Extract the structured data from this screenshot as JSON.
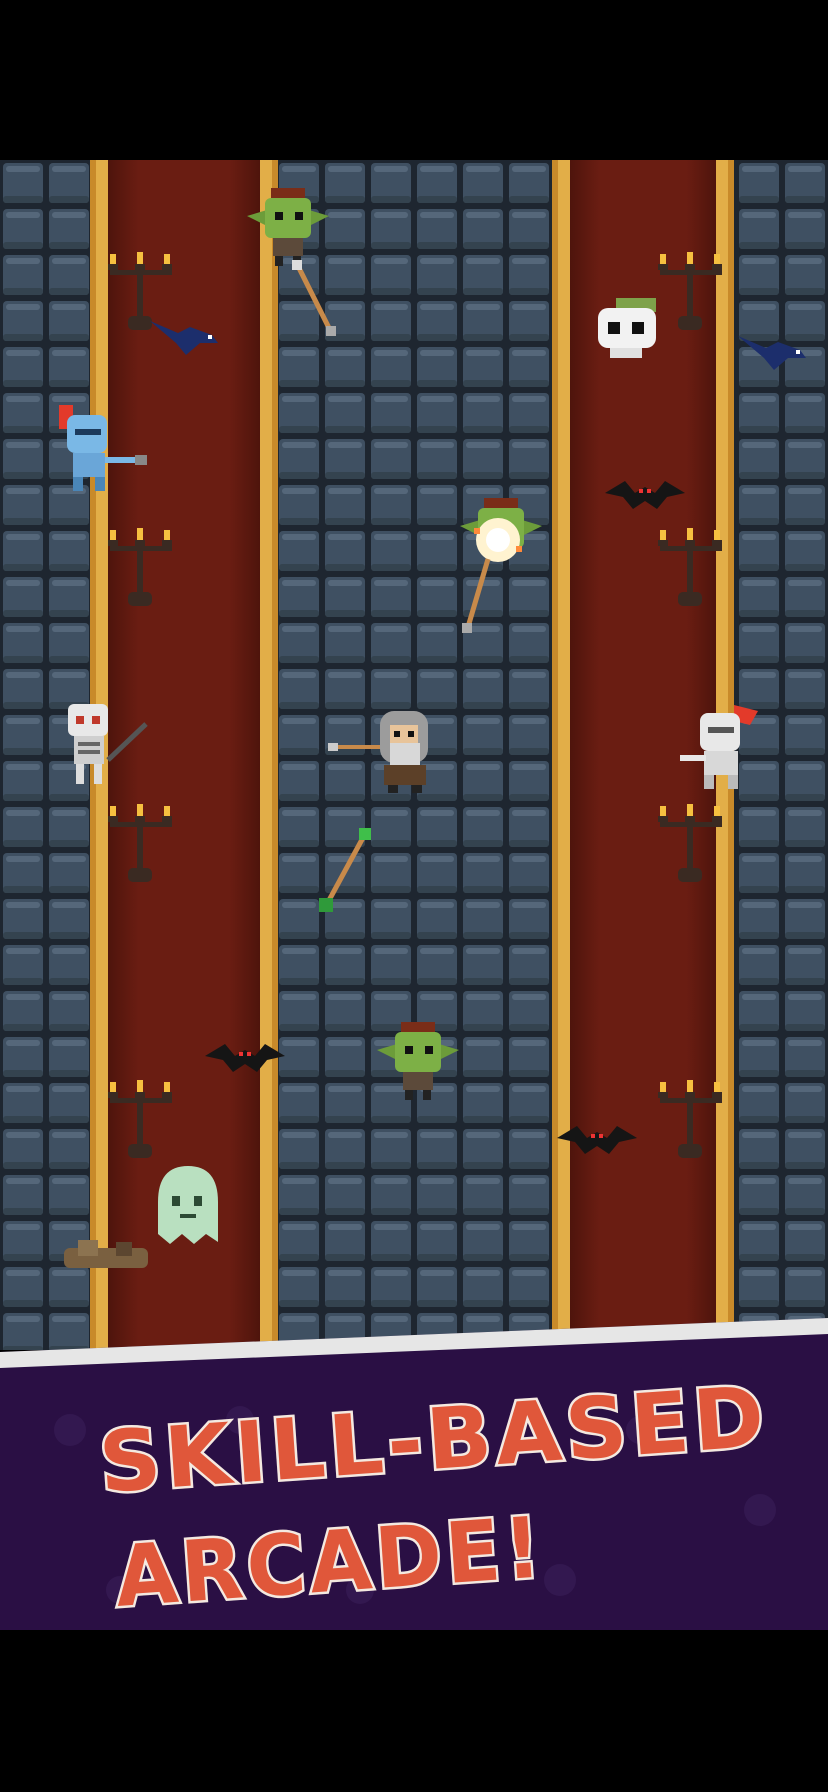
{
  "screen": {
    "caption_line_1": "SKILL-BASED",
    "caption_line_2": "ARCADE!"
  },
  "colors": {
    "background": "#000000",
    "stone": "#3f5062",
    "stone_highlight": "#6a7c8c",
    "stone_mortar": "#1e2630",
    "carpet": "#6a1d12",
    "carpet_gold_trim": "#d9a23a",
    "banner_purple": "#2a0f44",
    "banner_stripe": "#e6e6e6",
    "caption_fill": "#e0573a",
    "caption_outline": "#f4e9e0"
  },
  "sprites": {
    "goblin_top": "goblin-icon",
    "goblin_bottom": "goblin-icon",
    "goblin_hit": "goblin-icon",
    "wizard_player": "wizard-icon",
    "blue_knight": "blue-knight-icon",
    "white_knight": "white-knight-icon",
    "skeleton": "skeleton-icon",
    "ghost": "ghost-icon",
    "floating_skull": "skull-icon",
    "bats": "bat-icon",
    "crows": "crow-icon",
    "spears": "spear-icon",
    "candelabras": "candelabra-icon"
  }
}
